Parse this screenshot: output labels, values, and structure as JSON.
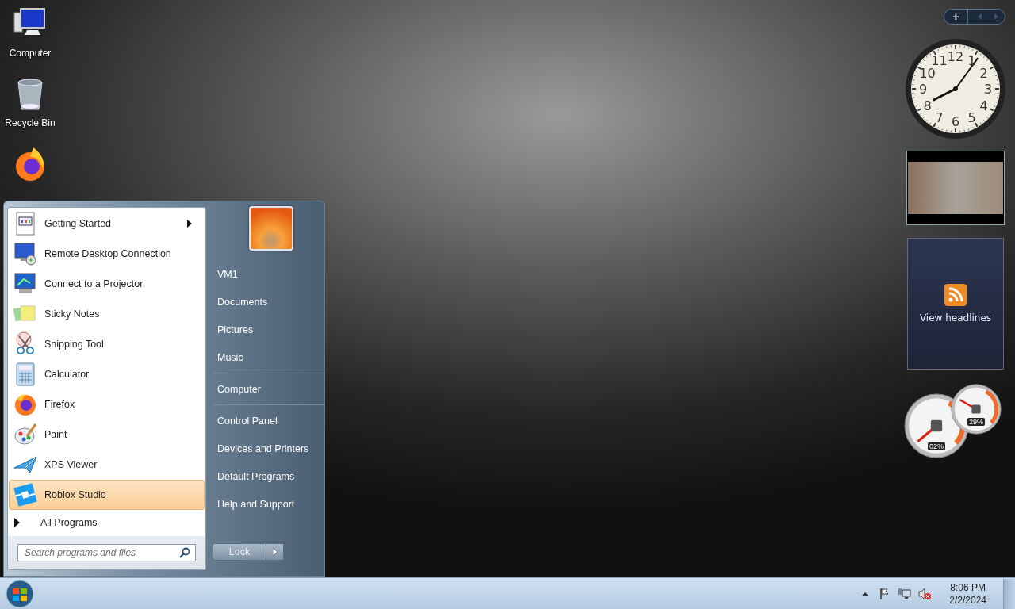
{
  "desktop_icons": [
    {
      "kind": "computer",
      "label": "Computer"
    },
    {
      "kind": "recycle-bin",
      "label": "Recycle Bin"
    },
    {
      "kind": "firefox"
    }
  ],
  "gadget_toolbar": {
    "add": "+"
  },
  "clock": {
    "numerals": [
      "12",
      "11",
      "1",
      "10",
      "2",
      "9",
      "3",
      "8",
      "4",
      "7",
      "5",
      "6"
    ]
  },
  "feed": {
    "label": "View headlines"
  },
  "meters": [
    {
      "kind": "cpu",
      "reading": "02%"
    },
    {
      "kind": "memory",
      "reading": "29%"
    }
  ],
  "start_menu": {
    "programs": [
      {
        "kind": "getting-started",
        "label": "Getting Started",
        "has_submenu": true,
        "selected": false
      },
      {
        "kind": "remote-desktop",
        "label": "Remote Desktop Connection",
        "has_submenu": false,
        "selected": false
      },
      {
        "kind": "projector",
        "label": "Connect to a Projector",
        "has_submenu": false,
        "selected": false
      },
      {
        "kind": "sticky-notes",
        "label": "Sticky Notes",
        "has_submenu": false,
        "selected": false
      },
      {
        "kind": "snipping",
        "label": "Snipping Tool",
        "has_submenu": false,
        "selected": false
      },
      {
        "kind": "calculator",
        "label": "Calculator",
        "has_submenu": false,
        "selected": false
      },
      {
        "kind": "firefox",
        "label": "Firefox",
        "has_submenu": false,
        "selected": false
      },
      {
        "kind": "paint",
        "label": "Paint",
        "has_submenu": false,
        "selected": false
      },
      {
        "kind": "xps",
        "label": "XPS Viewer",
        "has_submenu": false,
        "selected": false
      },
      {
        "kind": "roblox",
        "label": "Roblox Studio",
        "has_submenu": false,
        "selected": true
      }
    ],
    "all_programs": "All Programs",
    "search": {
      "placeholder": "Search programs and files"
    },
    "places": [
      [
        "VM1",
        "Documents",
        "Pictures",
        "Music"
      ],
      [
        "Computer"
      ],
      [
        "Control Panel",
        "Devices and Printers",
        "Default Programs",
        "Help and Support"
      ]
    ],
    "lock_button": "Lock"
  },
  "taskbar": {
    "time": "8:06 PM",
    "date": "2/2/2024"
  }
}
